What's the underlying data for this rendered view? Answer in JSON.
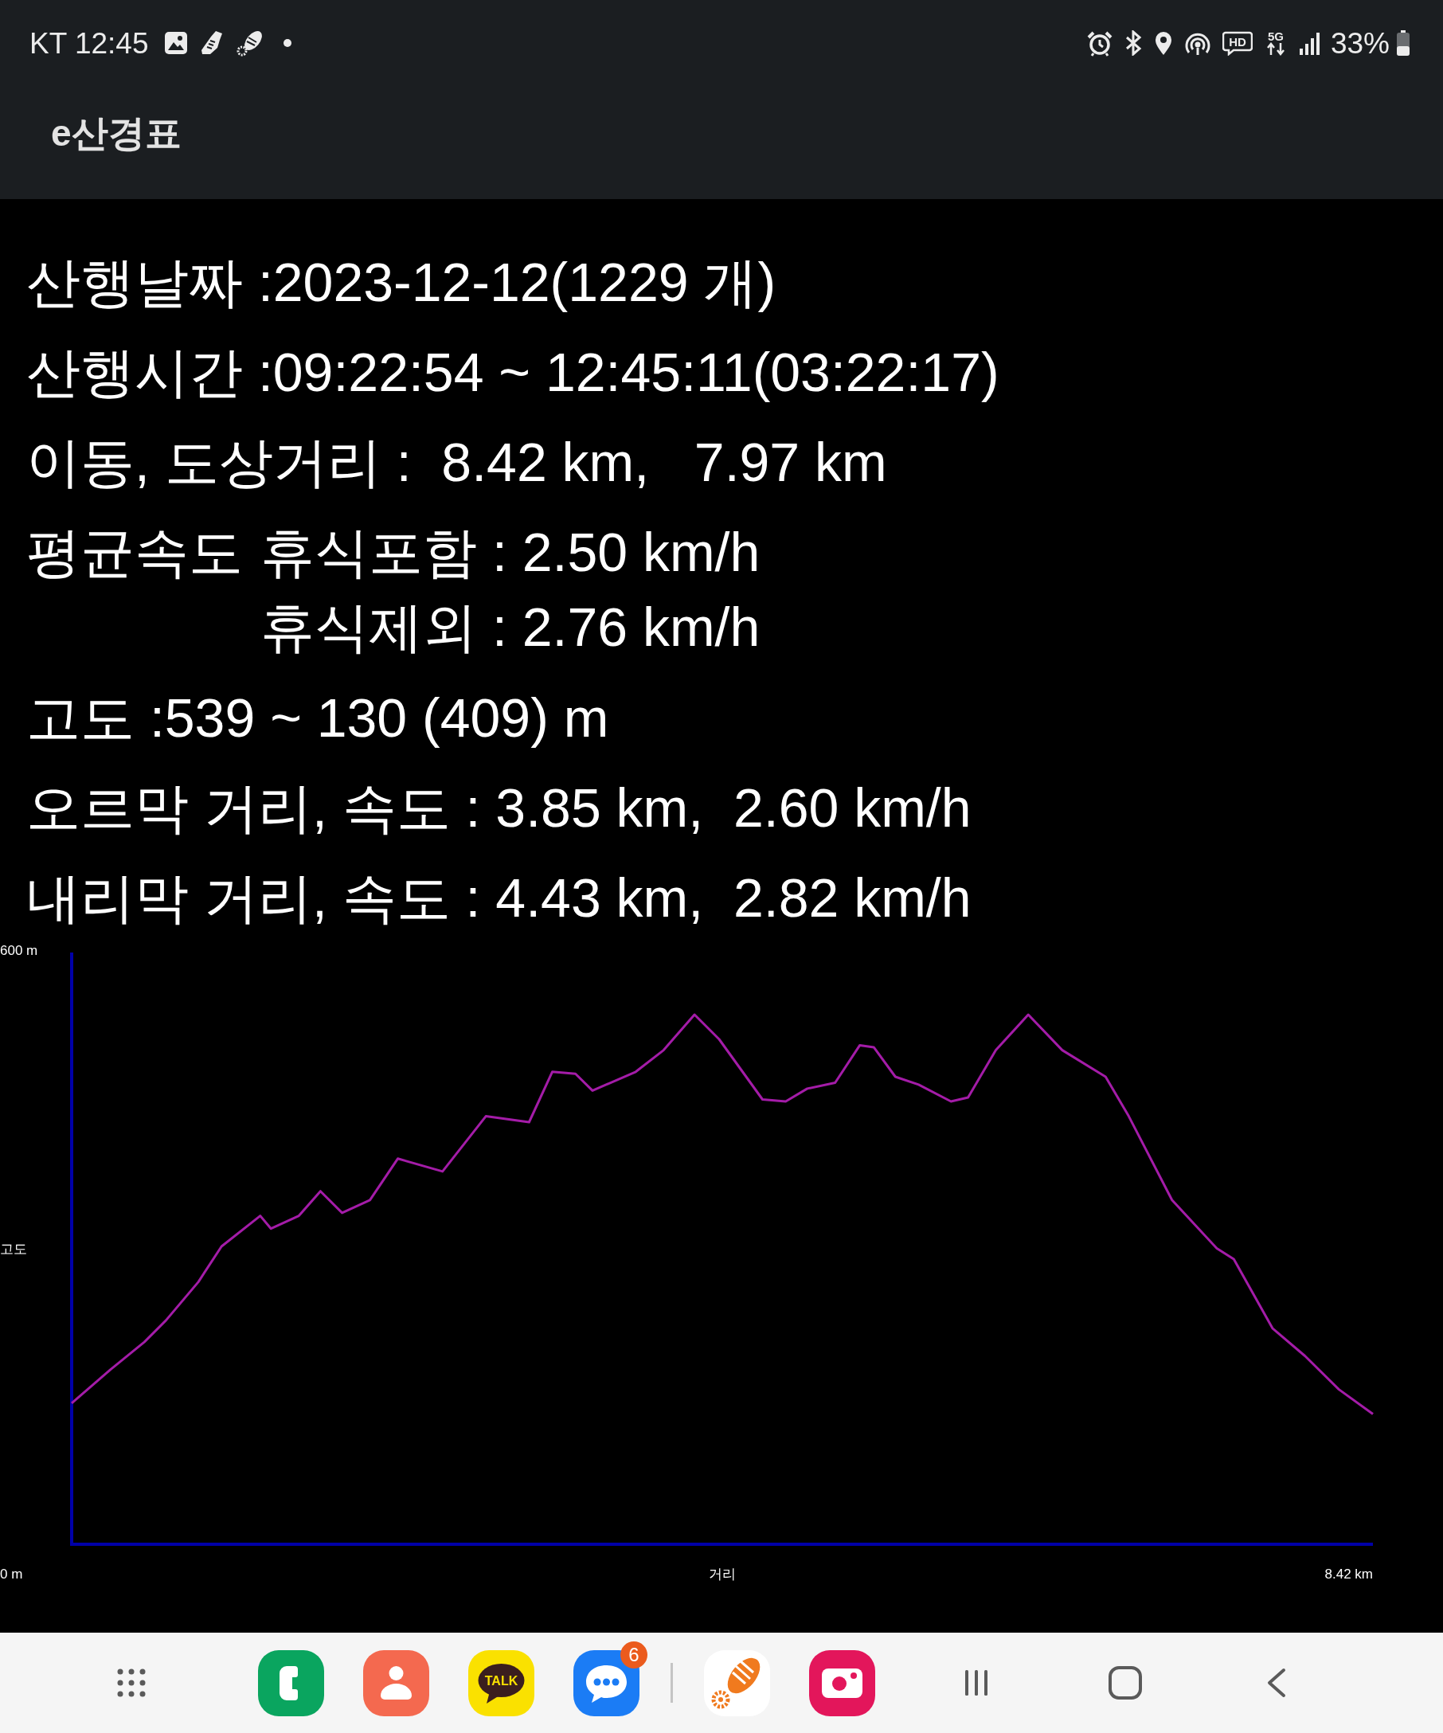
{
  "status_bar": {
    "carrier_time": "KT 12:45",
    "hd_label": "HD",
    "network_label": "5G",
    "battery": "33%"
  },
  "app_bar": {
    "title": "e산경표"
  },
  "stats": [
    {
      "kind": "line",
      "text": "산행날짜 :2023-12-12(1229 개)"
    },
    {
      "kind": "line",
      "text": "산행시간 :09:22:54 ~ 12:45:11(03:22:17)"
    },
    {
      "kind": "line",
      "text": "이동, 도상거리 :  8.42 km,   7.97 km"
    },
    {
      "kind": "group",
      "label": "평균속도",
      "items": [
        "휴식포함 : 2.50 km/h",
        "휴식제외 : 2.76 km/h"
      ]
    },
    {
      "kind": "line",
      "text": "고도 :539 ~ 130 (409) m"
    },
    {
      "kind": "line",
      "text": "오르막 거리, 속도 : 3.85 km,  2.60 km/h"
    },
    {
      "kind": "line",
      "text": "내리막 거리, 속도 : 4.43 km,  2.82 km/h"
    }
  ],
  "elevation_chart": {
    "y_top_label": "600 m",
    "y_title": "고도",
    "origin_label": "0 m",
    "x_title": "거리",
    "x_end_label": "8.42 km"
  },
  "dock": {
    "apps": [
      {
        "kind": "phone"
      },
      {
        "kind": "contacts"
      },
      {
        "kind": "talk",
        "text": "TALK"
      },
      {
        "kind": "messages",
        "badge": "6"
      },
      {
        "kind": "divider"
      },
      {
        "kind": "hiking"
      },
      {
        "kind": "camera"
      }
    ]
  }
}
